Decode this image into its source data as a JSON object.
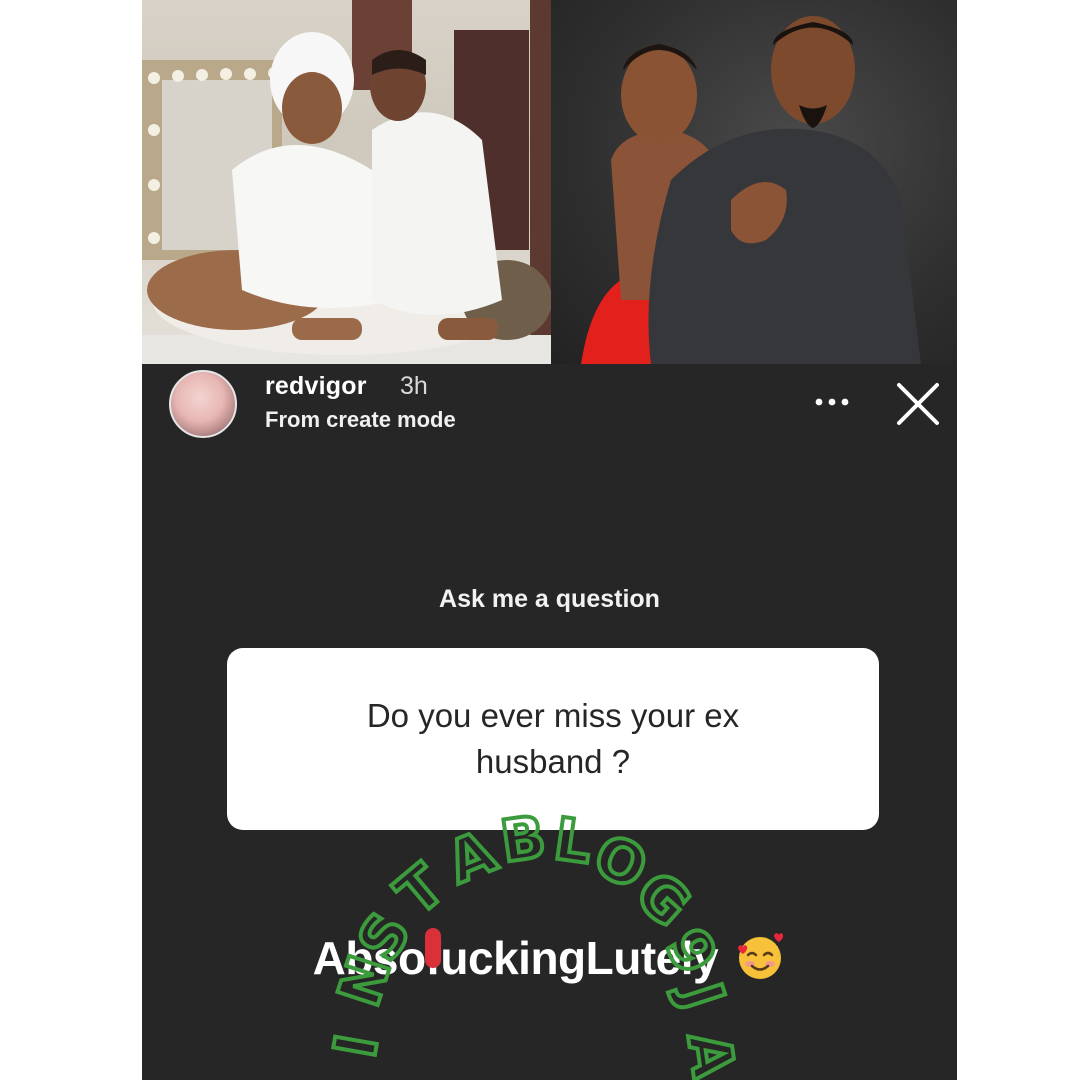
{
  "story": {
    "username": "redvigor",
    "time_ago": "3h",
    "subtitle": "From create mode",
    "more_icon": "more-options-icon",
    "close_icon": "close-icon"
  },
  "question_sticker": {
    "prompt": "Ask me a question",
    "question": "Do you ever miss your ex husband ?"
  },
  "answer": {
    "text": "AbsofuckingLutely",
    "emoji": "smiling-face-with-hearts"
  },
  "watermark": {
    "text": "INSTABLOG9JA"
  },
  "colors": {
    "background": "#262626",
    "card": "#ffffff",
    "watermark_green": "#3a9a3a",
    "accent_red": "#d9303a"
  }
}
